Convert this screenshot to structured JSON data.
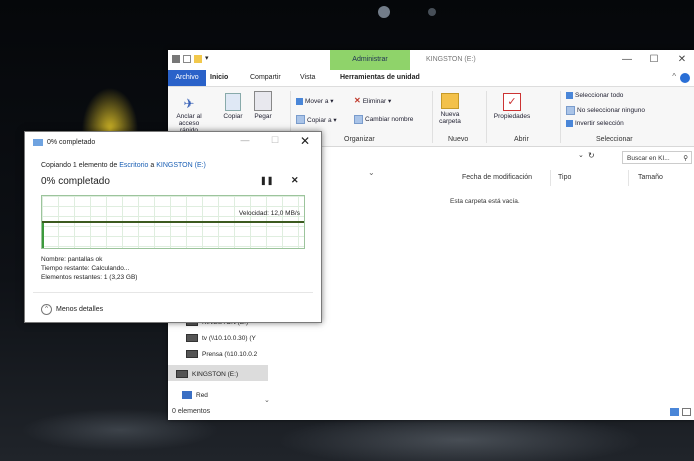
{
  "colors": {
    "accent": "#2a62c9",
    "admin_tab": "#8fd36a",
    "progress_graph": "#9cc49c",
    "link": "#1a5fb4"
  },
  "explorer": {
    "title": "KINGSTON (E:)",
    "contextual_tab": "Administrar",
    "tabs": {
      "file": "Archivo",
      "home": "Inicio",
      "share": "Compartir",
      "view": "Vista",
      "drive_tools": "Herramientas de unidad"
    },
    "ribbon": {
      "pin": "Anclar al acceso rápido",
      "copy": "Copiar",
      "paste": "Pegar",
      "move_to": "Mover a ▾",
      "copy_to": "Copiar a ▾",
      "delete": "Eliminar ▾",
      "rename": "Cambiar nombre",
      "new_folder": "Nueva carpeta",
      "properties": "Propiedades",
      "select_all": "Seleccionar todo",
      "select_none": "No seleccionar ninguno",
      "invert": "Invertir selección",
      "groups": {
        "organize": "Organizar",
        "new": "Nuevo",
        "open": "Abrir",
        "select": "Seleccionar"
      }
    },
    "search_placeholder": "Buscar en KI...",
    "columns": {
      "modified": "Fecha de modificación",
      "type": "Tipo",
      "size": "Tamaño"
    },
    "empty_message": "Esta carpeta está vacía.",
    "nav": [
      {
        "label": "KINGSTON (E:)",
        "icon": "drive-icon"
      },
      {
        "label": "tv (\\\\10.10.0.30) (Y",
        "icon": "network-drive-icon"
      },
      {
        "label": "Prensa (\\\\10.10.0.2",
        "icon": "network-drive-icon"
      },
      {
        "label": "KINGSTON (E:)",
        "icon": "usb-drive-icon"
      },
      {
        "label": "Red",
        "icon": "network-icon"
      }
    ],
    "status": "0 elementos"
  },
  "dialog": {
    "title": "0% completado",
    "copying_prefix": "Copiando 1 elemento de",
    "source": "Escritorio",
    "to_word": "a",
    "dest": "KINGSTON (E:)",
    "percent_text": "0% completado",
    "progress_fraction": 0.0,
    "speed": "Velocidad: 12,0 MB/s",
    "name": "Nombre: pantallas ok",
    "time_left": "Tiempo restante: Calculando...",
    "items_left": "Elementos restantes: 1 (3,23 GB)",
    "less_details": "Menos detalles"
  }
}
